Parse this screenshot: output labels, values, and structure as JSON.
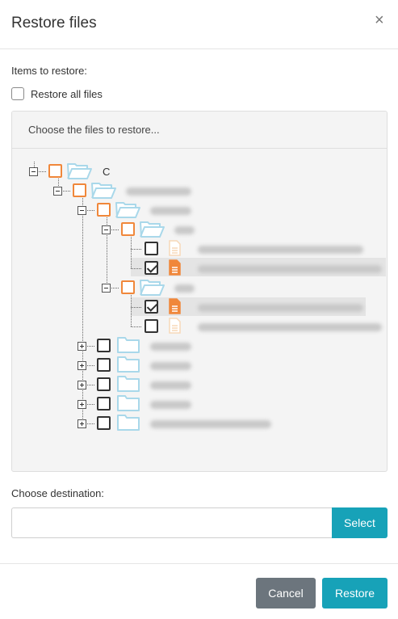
{
  "dialog": {
    "title": "Restore files",
    "close_glyph": "×"
  },
  "items_to_restore": {
    "label": "Items to restore:",
    "restore_all_label": "Restore all files",
    "restore_all_checked": false
  },
  "file_panel": {
    "header": "Choose the files to restore..."
  },
  "tree": {
    "root_label": "C",
    "nodes": [
      {
        "id": "root",
        "type": "folder",
        "label": "C",
        "expanded": true,
        "checked": false,
        "partial": true
      },
      {
        "id": "f1",
        "type": "folder",
        "label": "",
        "expanded": true,
        "checked": false,
        "partial": true
      },
      {
        "id": "f2",
        "type": "folder",
        "label": "",
        "expanded": true,
        "checked": false,
        "partial": true
      },
      {
        "id": "f3",
        "type": "folder",
        "label": "",
        "expanded": true,
        "checked": false,
        "partial": true
      },
      {
        "id": "file1",
        "type": "file",
        "label": "",
        "checked": false
      },
      {
        "id": "file2",
        "type": "file",
        "label": "",
        "checked": true
      },
      {
        "id": "f4",
        "type": "folder",
        "label": "",
        "expanded": true,
        "checked": false,
        "partial": true
      },
      {
        "id": "file3",
        "type": "file",
        "label": "",
        "checked": true
      },
      {
        "id": "file4",
        "type": "file",
        "label": "",
        "checked": false
      },
      {
        "id": "f5",
        "type": "folder",
        "label": "",
        "expanded": false,
        "checked": false
      },
      {
        "id": "f6",
        "type": "folder",
        "label": "",
        "expanded": false,
        "checked": false
      },
      {
        "id": "f7",
        "type": "folder",
        "label": "",
        "expanded": false,
        "checked": false
      },
      {
        "id": "f8",
        "type": "folder",
        "label": "",
        "expanded": false,
        "checked": false
      },
      {
        "id": "f9",
        "type": "folder",
        "label": "",
        "expanded": false,
        "checked": false
      }
    ]
  },
  "destination": {
    "label": "Choose destination:",
    "value": "",
    "placeholder": "",
    "select_label": "Select"
  },
  "footer": {
    "cancel_label": "Cancel",
    "restore_label": "Restore"
  },
  "colors": {
    "accent": "#17a2b8",
    "secondary": "#6c757d",
    "partial_checkbox": "#f0873a",
    "folder_icon": "#a9d8ea",
    "file_icon_checked": "#f0873a",
    "file_icon_unchecked": "#f7d8b8"
  },
  "icons": [
    "close-icon",
    "folder-icon",
    "folder-open-icon",
    "file-icon",
    "expand-icon",
    "collapse-icon",
    "checkbox-icon"
  ]
}
